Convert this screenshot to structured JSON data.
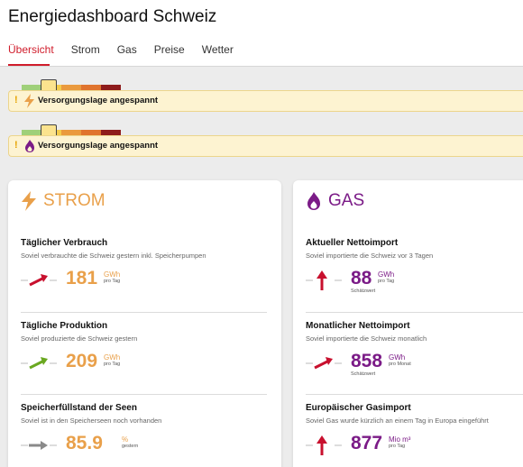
{
  "header": {
    "title": "Energiedashboard Schweiz",
    "tabs": [
      {
        "label": "Übersicht",
        "active": true
      },
      {
        "label": "Strom",
        "active": false
      },
      {
        "label": "Gas",
        "active": false
      },
      {
        "label": "Preise",
        "active": false
      },
      {
        "label": "Wetter",
        "active": false
      }
    ]
  },
  "colors": {
    "accent": "#d01c2b",
    "strom": "#e9a04a",
    "gas": "#7b1b87",
    "scale": [
      "#9fd07a",
      "#f4cc4c",
      "#ea9a3e",
      "#e0742e",
      "#8e1c1c"
    ]
  },
  "alerts": [
    {
      "icon": "lightning-icon",
      "text": "Versorgungslage angespannt",
      "level": 2
    },
    {
      "icon": "gas-flame-icon",
      "text": "Versorgungslage angespannt",
      "level": 2
    }
  ],
  "strom": {
    "title": "STROM",
    "items": [
      {
        "title": "Täglicher Verbrauch",
        "subtitle": "Soviel verbrauchte die Schweiz gestern inkl. Speicherpumpen",
        "value": "181",
        "unit": "GWh",
        "unit_sub": "pro Tag",
        "trend": "up",
        "trend_color": "#c8102e"
      },
      {
        "title": "Tägliche Produktion",
        "subtitle": "Soviel produzierte die Schweiz gestern",
        "value": "209",
        "unit": "GWh",
        "unit_sub": "pro Tag",
        "trend": "up",
        "trend_color": "#6aa820"
      },
      {
        "title": "Speicherfüllstand der Seen",
        "subtitle": "Soviel ist in den Speicherseen noch vorhanden",
        "value": "85.9",
        "unit": "%",
        "unit_sub": "gestern",
        "trend": "flat",
        "trend_color": "#8a8a8a"
      }
    ]
  },
  "gas": {
    "title": "GAS",
    "items": [
      {
        "title": "Aktueller Nettoimport",
        "subtitle": "Soviel importierte die Schweiz vor 3 Tagen",
        "value": "88",
        "unit": "GWh",
        "unit_sub": "pro Tag",
        "note": "Schätzwert",
        "trend": "strong-up",
        "trend_color": "#c8102e"
      },
      {
        "title": "Monatlicher Nettoimport",
        "subtitle": "Soviel importierte die Schweiz monatlich",
        "value": "858",
        "unit": "GWh",
        "unit_sub": "pro Monat",
        "note": "Schätzwert",
        "trend": "up",
        "trend_color": "#c8102e"
      },
      {
        "title": "Europäischer Gasimport",
        "subtitle": "Soviel Gas wurde kürzlich an einem Tag in Europa eingeführt",
        "value": "877",
        "unit": "Mio m³",
        "unit_sub": "pro Tag",
        "trend": "strong-up",
        "trend_color": "#c8102e"
      }
    ]
  }
}
